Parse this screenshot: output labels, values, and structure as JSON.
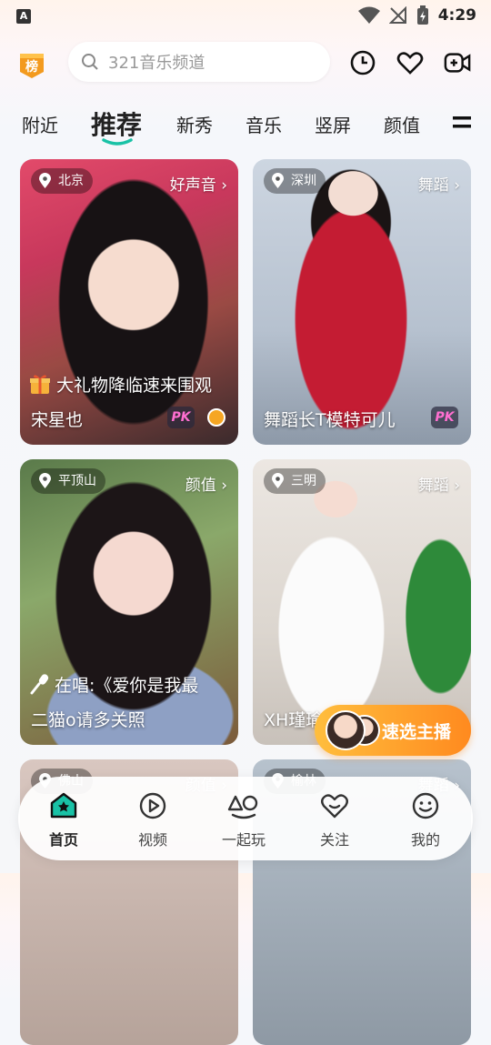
{
  "status_bar": {
    "time": "4:29"
  },
  "header": {
    "search_placeholder": "321音乐频道",
    "rank_badge": "榜"
  },
  "tabs": [
    {
      "label": "附近"
    },
    {
      "label": "推荐",
      "active": true
    },
    {
      "label": "新秀"
    },
    {
      "label": "音乐"
    },
    {
      "label": "竖屏"
    },
    {
      "label": "颜值"
    }
  ],
  "cards": [
    {
      "location": "北京",
      "category": "好声音 ›",
      "banner": "大礼物降临速来围观",
      "banner_icon": "gift-icon",
      "name": "宋星也",
      "pk": "PK"
    },
    {
      "location": "深圳",
      "category": "舞蹈 ›",
      "name": "舞蹈长T模特可儿",
      "pk": "PK"
    },
    {
      "location": "平顶山",
      "category": "颜值 ›",
      "banner": "在唱:《爱你是我最",
      "banner_icon": "microphone-icon",
      "name": "二猫o请多关照"
    },
    {
      "location": "三明",
      "category": "舞蹈 ›",
      "name": "XH瑾瑜"
    },
    {
      "location": "佛山",
      "category": "颜值 ›"
    },
    {
      "location": "榆林",
      "category": "舞蹈 ›"
    }
  ],
  "quick_pick": {
    "label": "速选主播"
  },
  "bottom_nav": [
    {
      "label": "首页",
      "icon": "home-icon",
      "active": true
    },
    {
      "label": "视频",
      "icon": "video-play-icon"
    },
    {
      "label": "一起玩",
      "icon": "play-together-icon"
    },
    {
      "label": "关注",
      "icon": "heart-smile-icon"
    },
    {
      "label": "我的",
      "icon": "profile-smile-icon"
    }
  ],
  "colors": {
    "accent": "#19c2a6",
    "quick_pick": "#ff9a24",
    "pk": "#ff6fd1"
  }
}
